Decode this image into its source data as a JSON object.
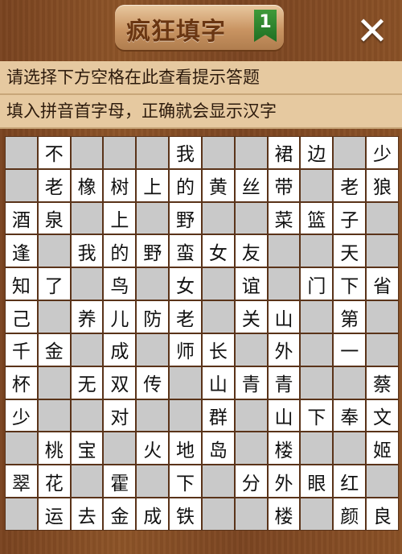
{
  "header": {
    "title": "疯狂填字",
    "level": "1",
    "close_label": "✕"
  },
  "hint": {
    "line1": "请选择下方空格在此查看提示答题",
    "line2": "填入拼音首字母，正确就会显示汉字"
  },
  "grid": [
    [
      "",
      "不",
      "",
      "",
      "",
      "我",
      "",
      "",
      "裙",
      "边",
      "",
      "少"
    ],
    [
      "",
      "老",
      "橡",
      "树",
      "上",
      "的",
      "黄",
      "丝",
      "带",
      "",
      "老",
      "狼"
    ],
    [
      "酒",
      "泉",
      "",
      "上",
      "",
      "野",
      "",
      "",
      "菜",
      "篮",
      "子",
      ""
    ],
    [
      "逢",
      "",
      "我",
      "的",
      "野",
      "蛮",
      "女",
      "友",
      "",
      "",
      "天",
      ""
    ],
    [
      "知",
      "了",
      "",
      "鸟",
      "",
      "女",
      "",
      "谊",
      "",
      "门",
      "下",
      "省"
    ],
    [
      "己",
      "",
      "养",
      "儿",
      "防",
      "老",
      "",
      "关",
      "山",
      "",
      "第",
      ""
    ],
    [
      "千",
      "金",
      "",
      "成",
      "",
      "师",
      "长",
      "",
      "外",
      "",
      "一",
      ""
    ],
    [
      "杯",
      "",
      "无",
      "双",
      "传",
      "",
      "山",
      "青",
      "青",
      "",
      "",
      "蔡"
    ],
    [
      "少",
      "",
      "",
      "对",
      "",
      "",
      "群",
      "",
      "山",
      "下",
      "奉",
      "文"
    ],
    [
      "",
      "桃",
      "宝",
      "",
      "火",
      "地",
      "岛",
      "",
      "楼",
      "",
      "",
      "姬"
    ],
    [
      "翠",
      "花",
      "",
      "霍",
      "",
      "下",
      "",
      "分",
      "外",
      "眼",
      "红",
      ""
    ],
    [
      "",
      "运",
      "去",
      "金",
      "成",
      "铁",
      "",
      "",
      "楼",
      "",
      "颜",
      "良"
    ]
  ]
}
